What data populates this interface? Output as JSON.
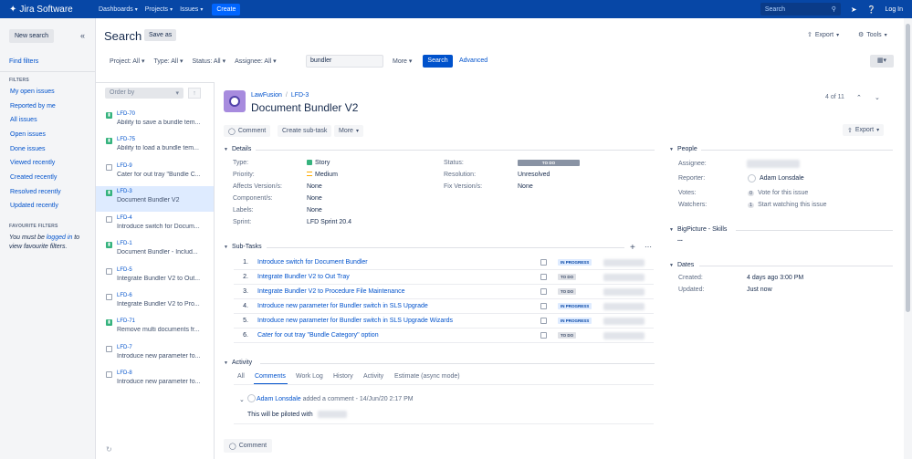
{
  "topnav": {
    "logo_text": "Jira Software",
    "items": [
      {
        "label": "Dashboards"
      },
      {
        "label": "Projects"
      },
      {
        "label": "Issues"
      }
    ],
    "create_label": "Create",
    "search_placeholder": "Search",
    "login_label": "Log In"
  },
  "sidebar": {
    "new_search_label": "New search",
    "find_filters_label": "Find filters",
    "filters_heading": "FILTERS",
    "filters": [
      "My open issues",
      "Reported by me",
      "All issues",
      "Open issues",
      "Done issues",
      "Viewed recently",
      "Created recently",
      "Resolved recently",
      "Updated recently"
    ],
    "favourite_heading": "FAVOURITE FILTERS",
    "fav_text_before": "You must be ",
    "fav_link": "logged in",
    "fav_text_after": " to view favourite filters."
  },
  "header": {
    "title": "Search",
    "save_as_label": "Save as",
    "export_label": "Export",
    "tools_label": "Tools"
  },
  "filters": {
    "project": "Project: All",
    "type": "Type: All",
    "status": "Status: All",
    "assignee": "Assignee: All",
    "text_value": "bundler",
    "more_label": "More",
    "search_label": "Search",
    "advanced_label": "Advanced"
  },
  "list": {
    "order_by_label": "Order by",
    "issues": [
      {
        "key": "LFD-70",
        "summary": "Ability to save a bundle tem...",
        "type": "story"
      },
      {
        "key": "LFD-75",
        "summary": "Ability to load a bundle tem...",
        "type": "story"
      },
      {
        "key": "LFD-9",
        "summary": "Cater for out tray \"Bundle C...",
        "type": "subtask"
      },
      {
        "key": "LFD-3",
        "summary": "Document Bundler V2",
        "type": "story"
      },
      {
        "key": "LFD-4",
        "summary": "Introduce switch for Docum...",
        "type": "subtask"
      },
      {
        "key": "LFD-1",
        "summary": "Document Bundler - Includ...",
        "type": "story"
      },
      {
        "key": "LFD-5",
        "summary": "Integrate Bundler V2 to Out...",
        "type": "subtask"
      },
      {
        "key": "LFD-6",
        "summary": "Integrate Bundler V2 to Pro...",
        "type": "subtask"
      },
      {
        "key": "LFD-71",
        "summary": "Remove multi documents fr...",
        "type": "story"
      },
      {
        "key": "LFD-7",
        "summary": "Introduce new parameter fo...",
        "type": "subtask"
      },
      {
        "key": "LFD-8",
        "summary": "Introduce new parameter fo...",
        "type": "subtask"
      }
    ]
  },
  "issue": {
    "project": "LawFusion",
    "key": "LFD-3",
    "title": "Document Bundler V2",
    "pager": "4 of 11",
    "comment_label": "Comment",
    "create_subtask_label": "Create sub-task",
    "more_label": "More",
    "export_label": "Export",
    "details_heading": "Details",
    "fields": {
      "type_label": "Type:",
      "type_value": "Story",
      "priority_label": "Priority:",
      "priority_value": "Medium",
      "affects_label": "Affects Version/s:",
      "affects_value": "None",
      "component_label": "Component/s:",
      "component_value": "None",
      "labels_label": "Labels:",
      "labels_value": "None",
      "sprint_label": "Sprint:",
      "sprint_value": "LFD Sprint 20.4",
      "status_label": "Status:",
      "status_value": "TO DO",
      "resolution_label": "Resolution:",
      "resolution_value": "Unresolved",
      "fix_label": "Fix Version/s:",
      "fix_value": "None"
    },
    "people": {
      "heading": "People",
      "assignee_label": "Assignee:",
      "reporter_label": "Reporter:",
      "reporter_value": "Adam Lonsdale",
      "votes_label": "Votes:",
      "votes_count": "0",
      "votes_text": "Vote for this issue",
      "watchers_label": "Watchers:",
      "watchers_count": "1",
      "watchers_text": "Start watching this issue"
    },
    "bigpicture": {
      "heading": "BigPicture - Skills",
      "value": "..."
    },
    "dates": {
      "heading": "Dates",
      "created_label": "Created:",
      "created_value": "4 days ago 3:00 PM",
      "updated_label": "Updated:",
      "updated_value": "Just now"
    },
    "subtasks_heading": "Sub-Tasks",
    "subtasks": [
      {
        "num": "1.",
        "summary": "Introduce switch for Document Bundler",
        "status": "IN PROGRESS"
      },
      {
        "num": "2.",
        "summary": "Integrate Bundler V2 to Out Tray",
        "status": "TO DO"
      },
      {
        "num": "3.",
        "summary": "Integrate Bundler V2 to Procedure File Maintenance",
        "status": "TO DO"
      },
      {
        "num": "4.",
        "summary": "Introduce new parameter for Bundler switch in SLS Upgrade",
        "status": "IN PROGRESS"
      },
      {
        "num": "5.",
        "summary": "Introduce new parameter for Bundler switch in SLS Upgrade Wizards",
        "status": "IN PROGRESS"
      },
      {
        "num": "6.",
        "summary": "Cater for out tray \"Bundle Category\" option",
        "status": "TO DO"
      }
    ],
    "activity": {
      "heading": "Activity",
      "tabs": [
        "All",
        "Comments",
        "Work Log",
        "History",
        "Activity",
        "Estimate (async mode)"
      ],
      "comment_author": "Adam Lonsdale",
      "comment_meta": " added a comment - 14/Jun/20 2:17 PM",
      "comment_text": "This will be piloted with"
    },
    "bottom_comment_label": "Comment"
  }
}
